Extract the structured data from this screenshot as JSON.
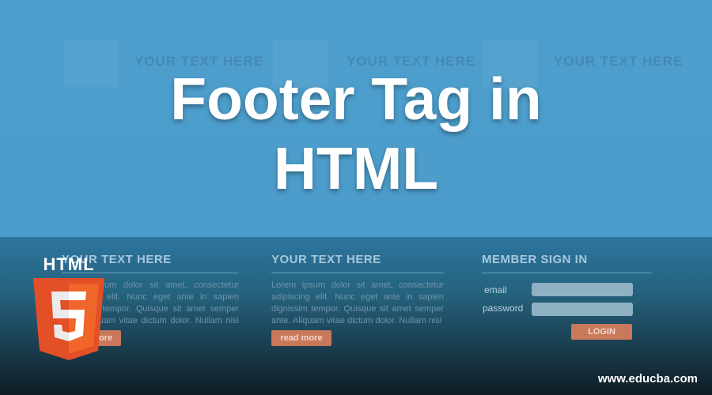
{
  "title_line1": "Footer Tag in",
  "title_line2": "HTML",
  "header_row": [
    "YOUR TEXT HERE",
    "YOUR TEXT HERE",
    "YOUR TEXT HERE"
  ],
  "columns": [
    {
      "heading": "YOUR TEXT HERE",
      "body": "Lorem ipsum dolor sit amet, consectetur adipiscing elit. Nunc eget ante in sapien dignissim tempor. Quisque sit amet semper ante. Aliquam vitae dictum dolor. Nullam nisi est,",
      "button": "read more"
    },
    {
      "heading": "YOUR TEXT HERE",
      "body": "Lorem ipsum dolor sit amet, consectetur adipiscing elit. Nunc eget ante in sapien dignissim tempor. Quisque sit amet semper ante. Aliquam vitae dictum dolor. Nullam nisi",
      "button": "read more"
    }
  ],
  "signin": {
    "heading": "MEMBER SIGN IN",
    "email_label": "email",
    "password_label": "password",
    "login_button": "LOGIN"
  },
  "logo": {
    "word": "HTML",
    "digit": "5",
    "colors": {
      "dark": "#e34f26",
      "light": "#ef652a",
      "shine": "#ffffff"
    }
  },
  "site": "www.educba.com",
  "colors": {
    "sky": "#4d9fcd",
    "button": "#c9795a"
  }
}
